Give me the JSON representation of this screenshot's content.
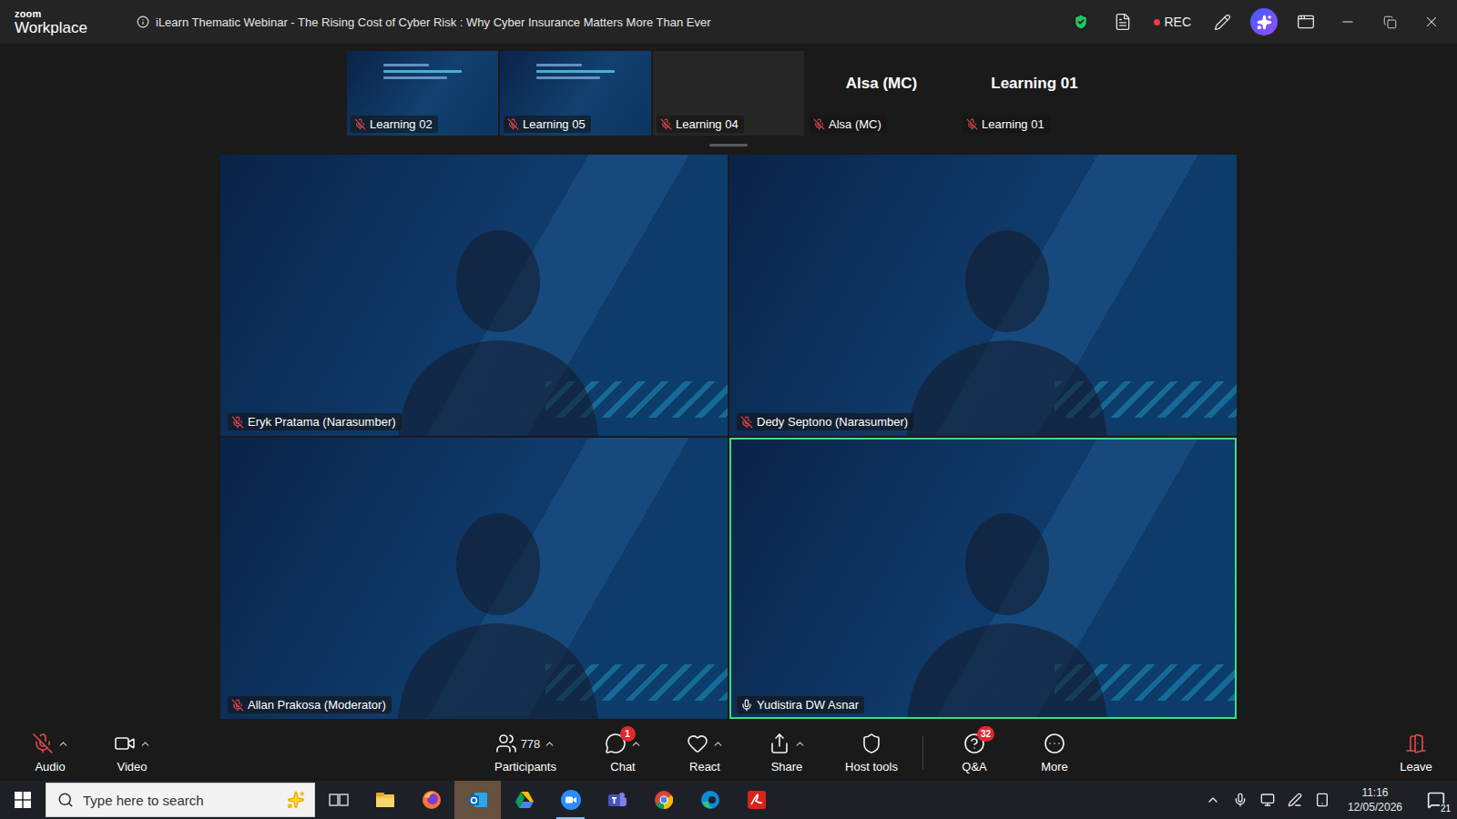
{
  "window": {
    "logo_top": "zoom",
    "logo_bottom": "Workplace",
    "title": "iLearn Thematic Webinar - The Rising Cost of Cyber Risk : Why Cyber Insurance Matters More Than Ever",
    "recording": true,
    "rec_label": "REC"
  },
  "thumbnails": [
    {
      "name": "Learning 02",
      "kind": "screen",
      "muted": true
    },
    {
      "name": "Learning 05",
      "kind": "screen",
      "muted": true
    },
    {
      "name": "Learning 04",
      "kind": "blank",
      "muted": true
    },
    {
      "name": "Alsa (MC)",
      "kind": "name",
      "muted": true
    },
    {
      "name": "Learning 01",
      "kind": "name",
      "muted": true
    }
  ],
  "tiles": [
    {
      "name": "Eryk Pratama (Narasumber)",
      "muted": true,
      "speaking": false
    },
    {
      "name": "Dedy Septono (Narasumber)",
      "muted": true,
      "speaking": false
    },
    {
      "name": "Allan Prakosa (Moderator)",
      "muted": true,
      "speaking": false
    },
    {
      "name": "Yudistira DW Asnar",
      "muted": false,
      "speaking": true
    }
  ],
  "toolbar": {
    "items": [
      {
        "label": "Audio",
        "muted": true,
        "menu": true
      },
      {
        "label": "Video",
        "muted": false,
        "menu": true
      },
      {
        "label": "Participants",
        "count": "778",
        "muted": false,
        "menu": true
      },
      {
        "label": "Chat",
        "badge": "1",
        "muted": false,
        "menu": true
      },
      {
        "label": "React",
        "muted": false,
        "menu": true
      },
      {
        "label": "Share",
        "muted": false,
        "menu": true
      },
      {
        "label": "Host tools",
        "muted": false,
        "menu": false
      },
      {
        "label": "Q&A",
        "badge": "32",
        "muted": false,
        "menu": false
      },
      {
        "label": "More",
        "muted": false,
        "menu": false
      }
    ],
    "leave": "Leave"
  },
  "taskbar": {
    "search_placeholder": "Type here to search",
    "time": "11:16",
    "date": "12/05/2026",
    "notifications": "21",
    "apps": [
      {
        "selected": false,
        "open": false
      },
      {
        "selected": false,
        "open": false
      },
      {
        "selected": true,
        "open": false
      },
      {
        "selected": false,
        "open": false
      },
      {
        "selected": false,
        "open": true
      },
      {
        "selected": false,
        "open": false
      },
      {
        "selected": false,
        "open": false
      },
      {
        "selected": false,
        "open": false
      },
      {
        "selected": false,
        "open": false
      }
    ]
  }
}
